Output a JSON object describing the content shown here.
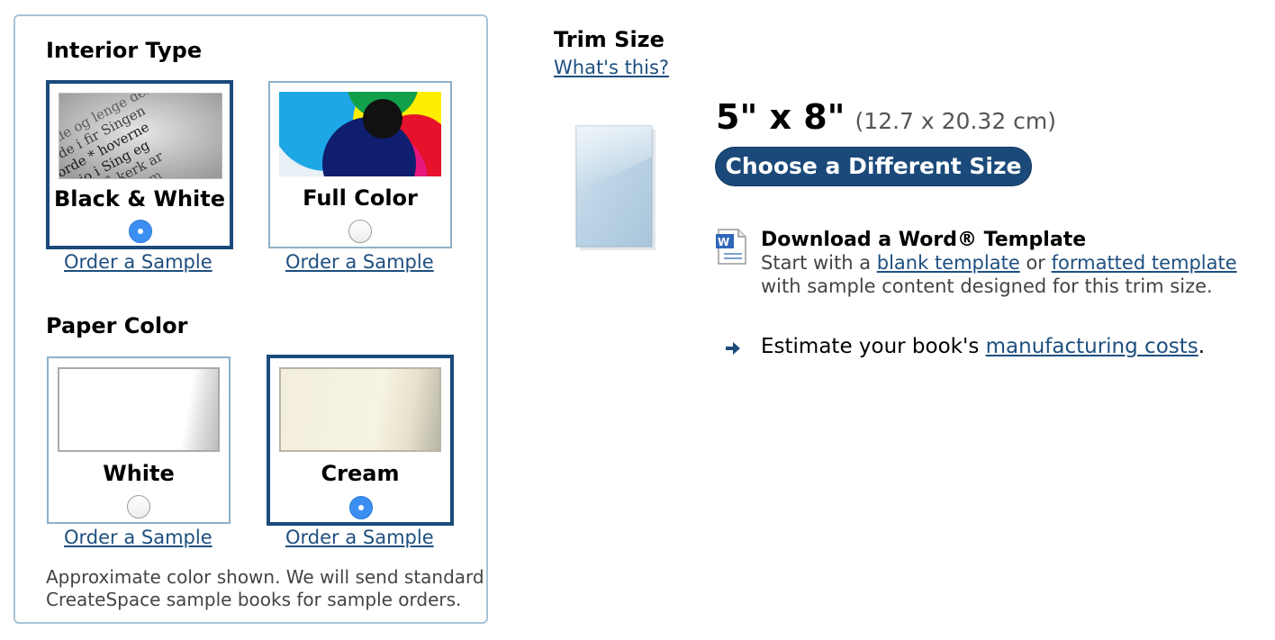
{
  "interior": {
    "heading": "Interior Type",
    "options": [
      {
        "label": "Black & White",
        "selected": true,
        "sample_link": "Order a Sample"
      },
      {
        "label": "Full Color",
        "selected": false,
        "sample_link": "Order a Sample"
      }
    ]
  },
  "paper": {
    "heading": "Paper Color",
    "options": [
      {
        "label": "White",
        "selected": false,
        "sample_link": "Order a Sample"
      },
      {
        "label": "Cream",
        "selected": true,
        "sample_link": "Order a Sample"
      }
    ],
    "note_line1": "Approximate color shown. We will send standard",
    "note_line2": "CreateSpace sample books for sample orders."
  },
  "trim": {
    "heading": "Trim Size",
    "whats_this": "What's this?",
    "size": "5\" x 8\"",
    "size_metric": "(12.7 x 20.32 cm)",
    "choose_button": "Choose a Different Size"
  },
  "template": {
    "title": "Download a Word® Template",
    "start_with": "Start with a",
    "blank_link": "blank template",
    "or": "or",
    "formatted_link": "formatted template",
    "line2": "with sample content designed for this trim size."
  },
  "estimate": {
    "prefix": "Estimate your book's",
    "link": "manufacturing costs",
    "suffix": "."
  },
  "colors": {
    "accent": "#1b4a7a",
    "link": "#1e4f80",
    "radio_selected": "#3b8ff0",
    "panel_border": "#a9c3d6",
    "cream": "#f5f0dc"
  },
  "icons": [
    "word-doc-icon",
    "arrow-right-icon",
    "book-thumbnail"
  ]
}
